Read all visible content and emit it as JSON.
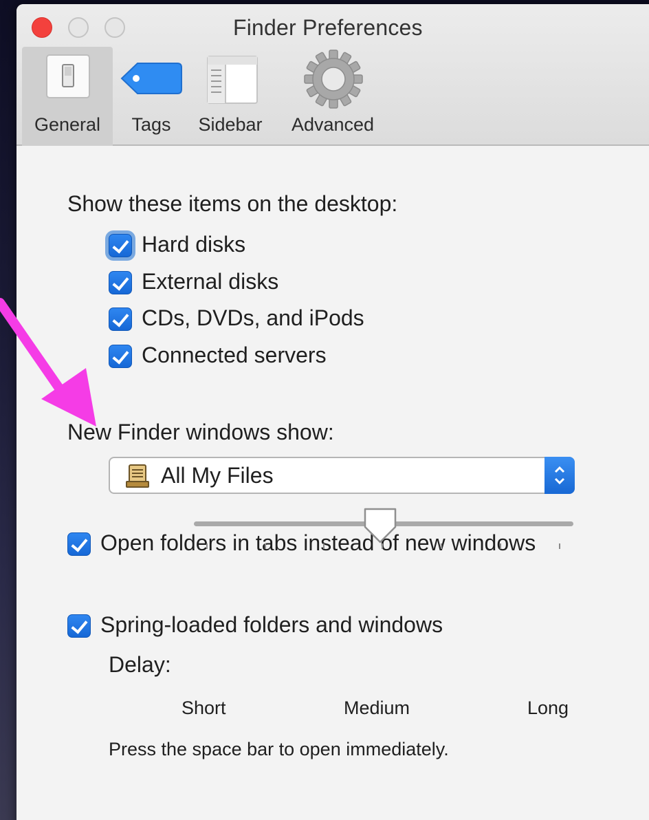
{
  "window": {
    "title": "Finder Preferences"
  },
  "toolbar": {
    "tabs": [
      {
        "label": "General",
        "icon": "general-switch-icon",
        "selected": true
      },
      {
        "label": "Tags",
        "icon": "tag-icon",
        "selected": false
      },
      {
        "label": "Sidebar",
        "icon": "sidebar-icon",
        "selected": false
      },
      {
        "label": "Advanced",
        "icon": "gear-icon",
        "selected": false
      }
    ]
  },
  "desktop_section": {
    "heading": "Show these items on the desktop:",
    "items": [
      {
        "label": "Hard disks",
        "checked": true
      },
      {
        "label": "External disks",
        "checked": true
      },
      {
        "label": "CDs, DVDs, and iPods",
        "checked": true
      },
      {
        "label": "Connected servers",
        "checked": true
      }
    ]
  },
  "new_window_section": {
    "heading": "New Finder windows show:",
    "selected_value": "All My Files",
    "icon": "all-my-files-icon"
  },
  "tabs_option": {
    "label": "Open folders in tabs instead of new windows",
    "checked": true
  },
  "spring_loaded": {
    "label": "Spring-loaded folders and windows",
    "checked": true,
    "delay_label": "Delay:",
    "delay_level": 0.5,
    "ticks": [
      "Short",
      "Medium",
      "Long"
    ],
    "hint": "Press the space bar to open immediately."
  },
  "annotation": {
    "arrow_color": "#f53ce6"
  },
  "colors": {
    "accent": "#1a6ee0",
    "close_button": "#f3413d"
  }
}
